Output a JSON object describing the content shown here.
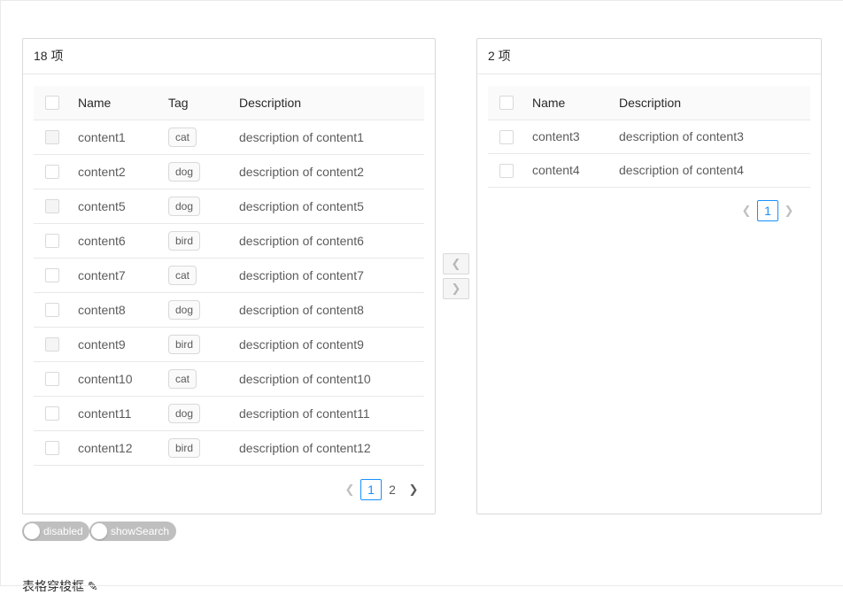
{
  "left_panel": {
    "count_label": "18 项",
    "columns": {
      "name": "Name",
      "tag": "Tag",
      "description": "Description"
    },
    "rows": [
      {
        "name": "content1",
        "tag": "cat",
        "description": "description of content1",
        "disabled": true
      },
      {
        "name": "content2",
        "tag": "dog",
        "description": "description of content2",
        "disabled": false
      },
      {
        "name": "content5",
        "tag": "dog",
        "description": "description of content5",
        "disabled": true
      },
      {
        "name": "content6",
        "tag": "bird",
        "description": "description of content6",
        "disabled": false
      },
      {
        "name": "content7",
        "tag": "cat",
        "description": "description of content7",
        "disabled": false
      },
      {
        "name": "content8",
        "tag": "dog",
        "description": "description of content8",
        "disabled": false
      },
      {
        "name": "content9",
        "tag": "bird",
        "description": "description of content9",
        "disabled": true
      },
      {
        "name": "content10",
        "tag": "cat",
        "description": "description of content10",
        "disabled": false
      },
      {
        "name": "content11",
        "tag": "dog",
        "description": "description of content11",
        "disabled": false
      },
      {
        "name": "content12",
        "tag": "bird",
        "description": "description of content12",
        "disabled": false
      }
    ],
    "pagination": {
      "pages": [
        "1",
        "2"
      ],
      "current": "1",
      "prev_icon": "chevron-left-icon",
      "next_icon": "chevron-right-icon"
    }
  },
  "right_panel": {
    "count_label": "2 项",
    "columns": {
      "name": "Name",
      "description": "Description"
    },
    "rows": [
      {
        "name": "content3",
        "description": "description of content3"
      },
      {
        "name": "content4",
        "description": "description of content4"
      }
    ],
    "pagination": {
      "pages": [
        "1"
      ],
      "current": "1",
      "prev_icon": "chevron-left-icon",
      "next_icon": "chevron-right-icon"
    }
  },
  "operations": {
    "move_left_icon": "chevron-left-icon",
    "move_right_icon": "chevron-right-icon"
  },
  "switches": {
    "disabled_label": "disabled",
    "show_search_label": "showSearch"
  },
  "section": {
    "title": "表格穿梭框 ✎"
  },
  "colors": {
    "primary": "#1890ff",
    "border": "#d9d9d9",
    "switch_off": "#bfbfbf"
  }
}
